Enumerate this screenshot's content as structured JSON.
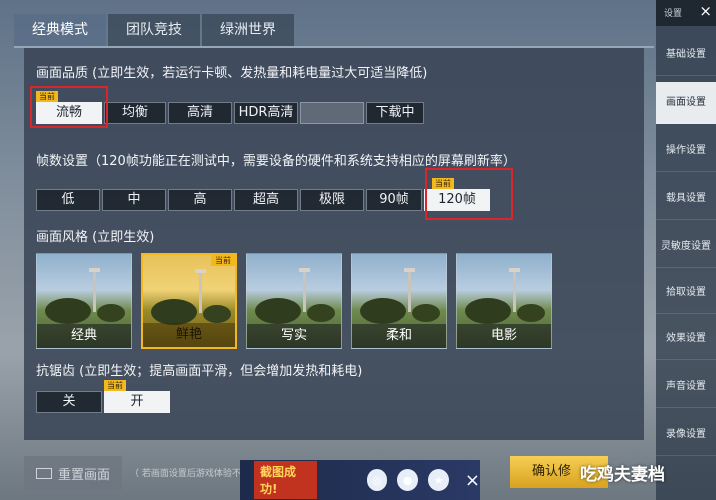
{
  "top_tabs": [
    {
      "label": "经典模式",
      "active": true
    },
    {
      "label": "团队竞技",
      "active": false
    },
    {
      "label": "绿洲世界",
      "active": false
    }
  ],
  "quality": {
    "title": "画面品质 (立即生效，若运行卡顿、发热量和耗电量过大可适当降低)",
    "options": [
      "流畅",
      "均衡",
      "高清",
      "HDR高清",
      "",
      "下载中"
    ],
    "selected": "流畅",
    "current_badge": "当前"
  },
  "fps": {
    "title": "帧数设置（120帧功能正在测试中，需要设备的硬件和系统支持相应的屏幕刷新率）",
    "options": [
      "低",
      "中",
      "高",
      "超高",
      "极限",
      "90帧",
      "120帧"
    ],
    "selected": "120帧",
    "current_badge": "当前"
  },
  "style": {
    "title": "画面风格 (立即生效)",
    "options": [
      "经典",
      "鲜艳",
      "写实",
      "柔和",
      "电影"
    ],
    "selected": "鲜艳",
    "current_badge": "当前"
  },
  "aa": {
    "title": "抗锯齿 (立即生效；提高画面平滑，但会增加发热和耗电)",
    "options": [
      "关",
      "开"
    ],
    "selected": "开",
    "current_badge": "当前"
  },
  "sidebar": {
    "header": "设置",
    "close": "×",
    "items": [
      "基础设置",
      "画面设置",
      "操作设置",
      "载具设置",
      "灵敏度设置",
      "拾取设置",
      "效果设置",
      "声音设置",
      "录像设置"
    ],
    "active": "画面设置"
  },
  "bottom": {
    "reset_label": "重置画面",
    "hint": "（ 若画面设置后游戏体验不",
    "toast_text": "截图成功!",
    "toast_close": "×",
    "confirm_label": "确认修",
    "watermark": "吃鸡夫妻档"
  },
  "colors": {
    "accent": "#f2b81e",
    "highlight_box": "#d9262a",
    "active_sidebar": "#e8ecef"
  }
}
